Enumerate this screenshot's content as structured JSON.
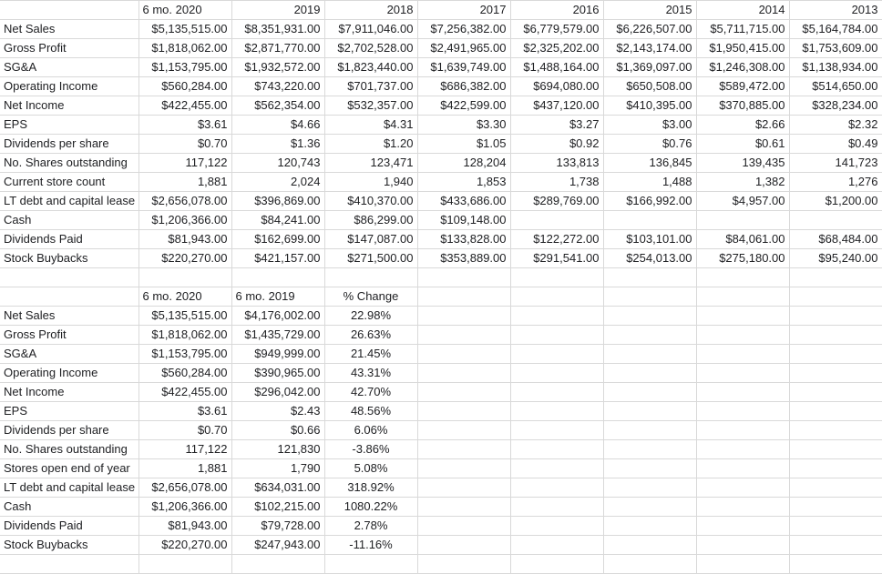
{
  "app": {
    "type": "spreadsheet",
    "grid_line_color": "#d9d9d9",
    "text_color": "#202124",
    "background": "#ffffff"
  },
  "table_annual": {
    "name": "annual-metrics-table",
    "headers": [
      "",
      "6 mo. 2020",
      "2019",
      "2018",
      "2017",
      "2016",
      "2015",
      "2014",
      "2013"
    ],
    "rows": [
      {
        "label": "Net Sales",
        "values": [
          "$5,135,515.00",
          "$8,351,931.00",
          "$7,911,046.00",
          "$7,256,382.00",
          "$6,779,579.00",
          "$6,226,507.00",
          "$5,711,715.00",
          "$5,164,784.00"
        ]
      },
      {
        "label": "Gross Profit",
        "values": [
          "$1,818,062.00",
          "$2,871,770.00",
          "$2,702,528.00",
          "$2,491,965.00",
          "$2,325,202.00",
          "$2,143,174.00",
          "$1,950,415.00",
          "$1,753,609.00"
        ]
      },
      {
        "label": "SG&A",
        "values": [
          "$1,153,795.00",
          "$1,932,572.00",
          "$1,823,440.00",
          "$1,639,749.00",
          "$1,488,164.00",
          "$1,369,097.00",
          "$1,246,308.00",
          "$1,138,934.00"
        ]
      },
      {
        "label": "Operating Income",
        "values": [
          "$560,284.00",
          "$743,220.00",
          "$701,737.00",
          "$686,382.00",
          "$694,080.00",
          "$650,508.00",
          "$589,472.00",
          "$514,650.00"
        ]
      },
      {
        "label": "Net Income",
        "values": [
          "$422,455.00",
          "$562,354.00",
          "$532,357.00",
          "$422,599.00",
          "$437,120.00",
          "$410,395.00",
          "$370,885.00",
          "$328,234.00"
        ]
      },
      {
        "label": "EPS",
        "values": [
          "$3.61",
          "$4.66",
          "$4.31",
          "$3.30",
          "$3.27",
          "$3.00",
          "$2.66",
          "$2.32"
        ]
      },
      {
        "label": "Dividends per share",
        "values": [
          "$0.70",
          "$1.36",
          "$1.20",
          "$1.05",
          "$0.92",
          "$0.76",
          "$0.61",
          "$0.49"
        ]
      },
      {
        "label": "No. Shares outstanding",
        "values": [
          "117,122",
          "120,743",
          "123,471",
          "128,204",
          "133,813",
          "136,845",
          "139,435",
          "141,723"
        ]
      },
      {
        "label": "Current store count",
        "values": [
          "1,881",
          "2,024",
          "1,940",
          "1,853",
          "1,738",
          "1,488",
          "1,382",
          "1,276"
        ]
      },
      {
        "label": "LT debt and capital lease",
        "values": [
          "$2,656,078.00",
          "$396,869.00",
          "$410,370.00",
          "$433,686.00",
          "$289,769.00",
          "$166,992.00",
          "$4,957.00",
          "$1,200.00"
        ]
      },
      {
        "label": "Cash",
        "values": [
          "$1,206,366.00",
          "$84,241.00",
          "$86,299.00",
          "$109,148.00",
          "",
          "",
          "",
          ""
        ]
      },
      {
        "label": "Dividends Paid",
        "values": [
          "$81,943.00",
          "$162,699.00",
          "$147,087.00",
          "$133,828.00",
          "$122,272.00",
          "$103,101.00",
          "$84,061.00",
          "$68,484.00"
        ]
      },
      {
        "label": "Stock Buybacks",
        "values": [
          "$220,270.00",
          "$421,157.00",
          "$271,500.00",
          "$353,889.00",
          "$291,541.00",
          "$254,013.00",
          "$275,180.00",
          "$95,240.00"
        ]
      }
    ]
  },
  "spacer_row": {
    "name": "spacer-row",
    "cells": [
      "",
      "",
      "",
      "",
      "",
      "",
      "",
      "",
      ""
    ]
  },
  "table_comparison": {
    "name": "six-month-comparison-table",
    "headers": [
      "",
      "6 mo. 2020",
      "6 mo. 2019",
      "% Change",
      "",
      "",
      "",
      "",
      ""
    ],
    "rows": [
      {
        "label": "Net Sales",
        "values": [
          "$5,135,515.00",
          "$4,176,002.00",
          "22.98%"
        ]
      },
      {
        "label": "Gross Profit",
        "values": [
          "$1,818,062.00",
          "$1,435,729.00",
          "26.63%"
        ]
      },
      {
        "label": "SG&A",
        "values": [
          "$1,153,795.00",
          "$949,999.00",
          "21.45%"
        ]
      },
      {
        "label": "Operating Income",
        "values": [
          "$560,284.00",
          "$390,965.00",
          "43.31%"
        ]
      },
      {
        "label": "Net Income",
        "values": [
          "$422,455.00",
          "$296,042.00",
          "42.70%"
        ]
      },
      {
        "label": "EPS",
        "values": [
          "$3.61",
          "$2.43",
          "48.56%"
        ]
      },
      {
        "label": "Dividends per share",
        "values": [
          "$0.70",
          "$0.66",
          "6.06%"
        ]
      },
      {
        "label": "No. Shares outstanding",
        "values": [
          "117,122",
          "121,830",
          "-3.86%"
        ]
      },
      {
        "label": "Stores open end of year",
        "values": [
          "1,881",
          "1,790",
          "5.08%"
        ]
      },
      {
        "label": "LT debt and capital lease",
        "values": [
          "$2,656,078.00",
          "$634,031.00",
          "318.92%"
        ]
      },
      {
        "label": "Cash",
        "values": [
          "$1,206,366.00",
          "$102,215.00",
          "1080.22%"
        ]
      },
      {
        "label": "Dividends Paid",
        "values": [
          "$81,943.00",
          "$79,728.00",
          "2.78%"
        ]
      },
      {
        "label": "Stock Buybacks",
        "values": [
          "$220,270.00",
          "$247,943.00",
          "-11.16%"
        ]
      }
    ]
  },
  "trailing_row": {
    "name": "trailing-empty-row",
    "cells": [
      "",
      "",
      "",
      "",
      "",
      "",
      "",
      "",
      ""
    ]
  }
}
